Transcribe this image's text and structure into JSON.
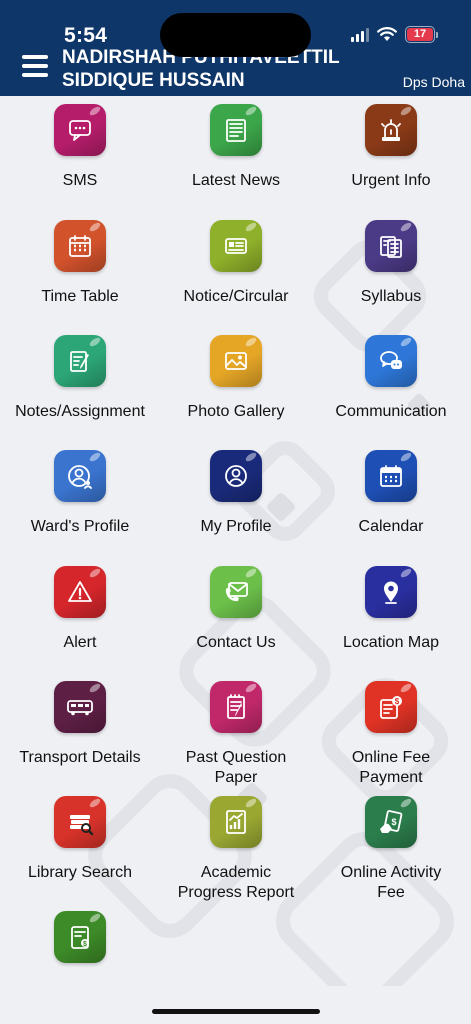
{
  "status_bar": {
    "time": "5:54",
    "battery": "17",
    "battery_color": "#e5394d"
  },
  "header": {
    "user_name": "NADIRSHAH PUTHIYAVEETTIL SIDDIQUE HUSSAIN",
    "school": "Dps Doha",
    "background_color": "#0f3668"
  },
  "tiles": [
    {
      "label": "SMS",
      "icon": "sms-icon",
      "color": "#b51d6b"
    },
    {
      "label": "Latest News",
      "icon": "newspaper-icon",
      "color": "#3ca64a"
    },
    {
      "label": "Urgent Info",
      "icon": "siren-icon",
      "color": "#8a3a17"
    },
    {
      "label": "Time Table",
      "icon": "calendar-grid-icon",
      "color": "#d2522c"
    },
    {
      "label": "Notice/Circular",
      "icon": "id-card-icon",
      "color": "#8fb02a"
    },
    {
      "label": "Syllabus",
      "icon": "books-icon",
      "color": "#4b3a86"
    },
    {
      "label": "Notes/Assignment",
      "icon": "notepad-pencil-icon",
      "color": "#2ca676"
    },
    {
      "label": "Photo Gallery",
      "icon": "photo-icon",
      "color": "#e5a626"
    },
    {
      "label": "Communication",
      "icon": "chat-bubbles-icon",
      "color": "#2e77d8"
    },
    {
      "label": "Ward's Profile",
      "icon": "ward-profile-icon",
      "color": "#3a74cf"
    },
    {
      "label": "My Profile",
      "icon": "user-profile-icon",
      "color": "#1a2a7a"
    },
    {
      "label": "Calendar",
      "icon": "calendar-icon",
      "color": "#1e4fb4"
    },
    {
      "label": "Alert",
      "icon": "warning-icon",
      "color": "#d4262b"
    },
    {
      "label": "Contact Us",
      "icon": "mail-phone-icon",
      "color": "#6cc04a"
    },
    {
      "label": "Location Map",
      "icon": "location-pin-icon",
      "color": "#2a2fa0"
    },
    {
      "label": "Transport Details",
      "icon": "bus-icon",
      "color": "#5e1f45"
    },
    {
      "label": "Past Question Paper",
      "icon": "question-paper-icon",
      "color": "#c0286a"
    },
    {
      "label": "Online Fee Payment",
      "icon": "fee-payment-icon",
      "color": "#e03325"
    },
    {
      "label": "Library Search",
      "icon": "library-books-icon",
      "color": "#d8332a"
    },
    {
      "label": "Academic Progress Report",
      "icon": "progress-report-icon",
      "color": "#9aa832"
    },
    {
      "label": "Online Activity Fee",
      "icon": "activity-fee-icon",
      "color": "#2c7d4c"
    },
    {
      "label": "",
      "icon": "fee-book-icon",
      "color": "#3d8a28"
    }
  ]
}
